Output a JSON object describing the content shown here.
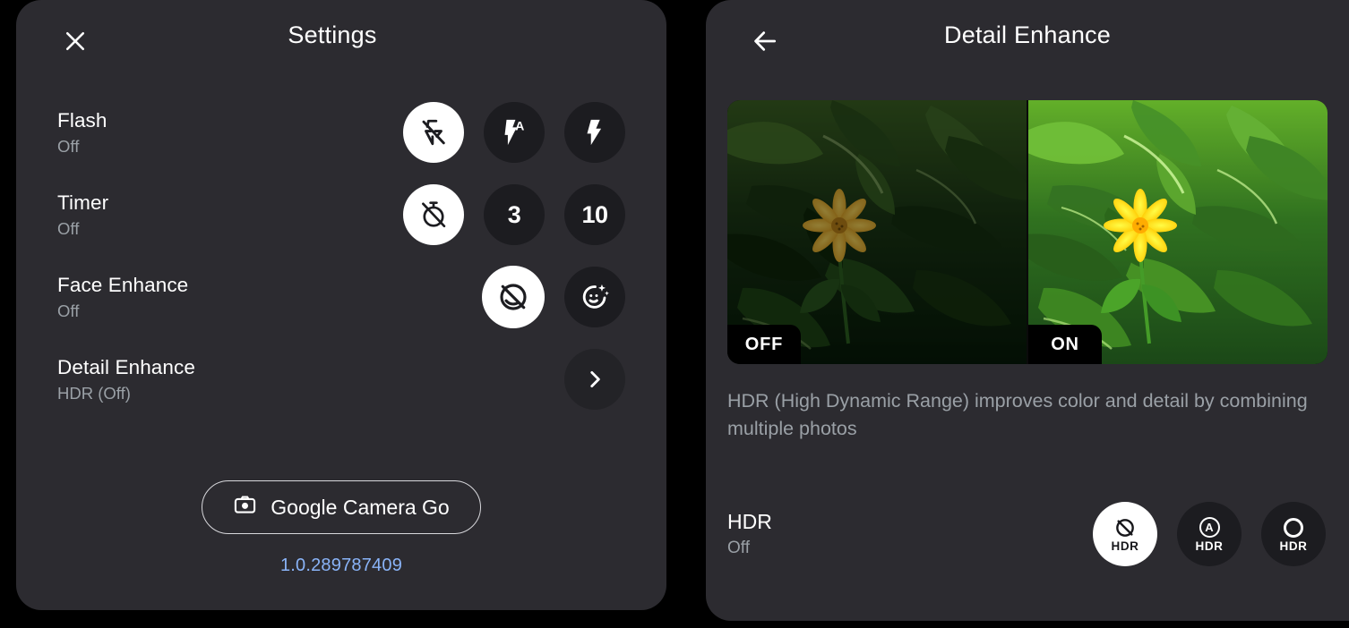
{
  "settings_panel": {
    "title": "Settings",
    "close_icon": "close-icon",
    "rows": [
      {
        "label": "Flash",
        "value": "Off",
        "options": [
          {
            "name": "flash-off",
            "icon": "flash-off-icon",
            "selected": true
          },
          {
            "name": "flash-auto",
            "icon": "flash-auto-icon",
            "selected": false
          },
          {
            "name": "flash-on",
            "icon": "flash-on-icon",
            "selected": false
          }
        ]
      },
      {
        "label": "Timer",
        "value": "Off",
        "options": [
          {
            "name": "timer-off",
            "icon": "timer-off-icon",
            "selected": true
          },
          {
            "name": "timer-3s",
            "icon": "text",
            "text": "3",
            "selected": false
          },
          {
            "name": "timer-10s",
            "icon": "text",
            "text": "10",
            "selected": false
          }
        ]
      },
      {
        "label": "Face Enhance",
        "value": "Off",
        "options": [
          {
            "name": "face-enhance-off",
            "icon": "face-off-icon",
            "selected": true
          },
          {
            "name": "face-enhance-on",
            "icon": "face-sparkle-icon",
            "selected": false
          }
        ]
      },
      {
        "label": "Detail Enhance",
        "value": "HDR (Off)",
        "options": [
          {
            "name": "detail-enhance-open",
            "icon": "chevron-right-icon",
            "selected": false
          }
        ]
      }
    ],
    "brand_button": {
      "label": "Google Camera Go",
      "icon": "camera-icon"
    },
    "version": "1.0.289787409",
    "version_color": "#8ab4f8"
  },
  "detail_panel": {
    "title": "Detail Enhance",
    "back_icon": "arrow-left-icon",
    "comparison": {
      "left_label": "OFF",
      "right_label": "ON",
      "subject": "yellow flower with green foliage"
    },
    "description": "HDR (High Dynamic Range) improves color and detail by combining multiple photos",
    "hdr_row": {
      "label": "HDR",
      "value": "Off",
      "options": [
        {
          "name": "hdr-off",
          "icon": "hdr-off-icon",
          "caption": "HDR",
          "selected": true
        },
        {
          "name": "hdr-auto",
          "icon": "hdr-auto-icon",
          "caption": "HDR",
          "letter": "A",
          "selected": false
        },
        {
          "name": "hdr-on",
          "icon": "hdr-on-icon",
          "caption": "HDR",
          "selected": false
        }
      ]
    }
  },
  "colors": {
    "panel_bg": "#2c2b30",
    "screen_bg": "#000000",
    "option_bg": "#1c1c20",
    "selected_bg": "#ffffff",
    "primary_text": "#ffffff",
    "secondary_text": "#9aa0a6",
    "accent": "#8ab4f8"
  }
}
